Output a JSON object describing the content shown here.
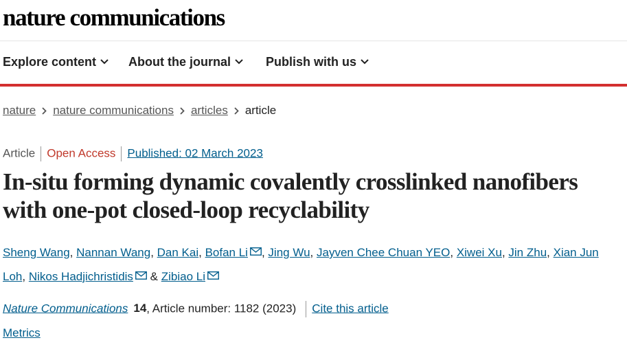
{
  "header": {
    "logo": "nature communications"
  },
  "nav": {
    "items": [
      {
        "label": "Explore content"
      },
      {
        "label": "About the journal"
      },
      {
        "label": "Publish with us"
      }
    ]
  },
  "breadcrumb": {
    "items": [
      "nature",
      "nature communications",
      "articles"
    ],
    "current": "article"
  },
  "article": {
    "type": "Article",
    "access": "Open Access",
    "published": "Published: 02 March 2023",
    "title": "In-situ forming dynamic covalently crosslinked nanofibers with one-pot closed-loop recyclability",
    "authors": [
      "Sheng Wang",
      "Nannan Wang",
      "Dan Kai",
      "Bofan Li",
      "Jing Wu",
      "Jayven Chee Chuan YEO",
      "Xiwei Xu",
      "Jin Zhu",
      "Xian Jun Loh",
      "Nikos Hadjichristidis",
      "Zibiao Li"
    ],
    "authors_ampersand": "&",
    "journal": "Nature Communications",
    "volume": "14",
    "article_number": ", Article number: 1182 (2023)",
    "cite_label": "Cite this article",
    "metrics_label": "Metrics"
  },
  "colors": {
    "accent_red": "#d32f2f",
    "link_blue": "#025e8d",
    "open_access": "#c0392b"
  },
  "icons": {
    "nav_chevron": "chevron-down-icon",
    "breadcrumb_sep": "chevron-right-icon",
    "author_mail": "mail-icon"
  }
}
